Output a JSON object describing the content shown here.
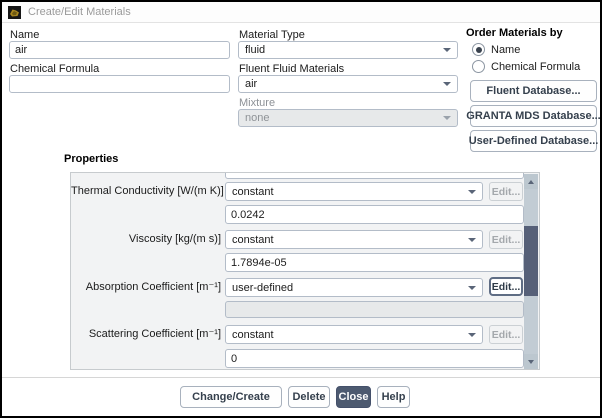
{
  "window": {
    "title": "Create/Edit Materials"
  },
  "left": {
    "name_label": "Name",
    "name_value": "air",
    "chemical_formula_label": "Chemical Formula",
    "chemical_formula_value": ""
  },
  "middle": {
    "material_type_label": "Material Type",
    "material_type_value": "fluid",
    "fluent_fluid_materials_label": "Fluent Fluid Materials",
    "fluent_fluid_materials_value": "air",
    "mixture_label": "Mixture",
    "mixture_value": "none"
  },
  "order_by": {
    "label": "Order Materials by",
    "radio_name": "Name",
    "radio_chemical_formula": "Chemical Formula",
    "selected": "Name"
  },
  "database_buttons": {
    "fluent": "Fluent Database...",
    "granta": "GRANTA MDS Database...",
    "user_defined": "User-Defined Database..."
  },
  "properties": {
    "label": "Properties",
    "rows": [
      {
        "label": "Thermal Conductivity [W/(m K)]",
        "method": "constant",
        "value": "0.0242",
        "edit_label": "Edit...",
        "edit_enabled": false
      },
      {
        "label": "Viscosity [kg/(m s)]",
        "method": "constant",
        "value": "1.7894e-05",
        "edit_label": "Edit...",
        "edit_enabled": false
      },
      {
        "label": "Absorption Coefficient [m⁻¹]",
        "method": "user-defined",
        "value": "",
        "edit_label": "Edit...",
        "edit_enabled": true
      },
      {
        "label": "Scattering Coefficient [m⁻¹]",
        "method": "constant",
        "value": "0",
        "edit_label": "Edit...",
        "edit_enabled": false
      }
    ]
  },
  "footer": {
    "change_create": "Change/Create",
    "delete": "Delete",
    "close": "Close",
    "help": "Help"
  },
  "colors": {
    "close_button_bg": "#4d5a70",
    "scroll_thumb": "#566078",
    "icon_gold": "#a8861f"
  }
}
